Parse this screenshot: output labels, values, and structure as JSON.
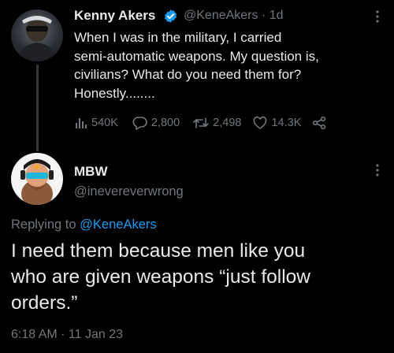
{
  "tweet": {
    "author_name": "Kenny Akers",
    "author_handle": "@KeneAkers",
    "separator": "·",
    "time_ago": "1d",
    "text": "When I was in the military, I carried\nsemi-automatic weapons. My question is,\ncivilians? What do you need them for?\nHonestly........",
    "stats": {
      "views": "540K",
      "replies": "2,800",
      "retweets": "2,498",
      "likes": "14.3K"
    },
    "verified_icon": "verified-badge-icon",
    "verified_color": "#1d9bf0"
  },
  "reply": {
    "author_name": "MBW",
    "author_handle": "@inevereverwrong",
    "replying_prefix": "Replying to",
    "replying_to": "@KeneAkers",
    "text": "I need them because men like you\nwho are given weapons “just follow\norders.”",
    "timestamp": "6:18 AM · 11 Jan 23"
  },
  "colors": {
    "background": "#000000",
    "text": "#e7e9ea",
    "muted": "#71767b",
    "accent": "#1d9bf0"
  }
}
